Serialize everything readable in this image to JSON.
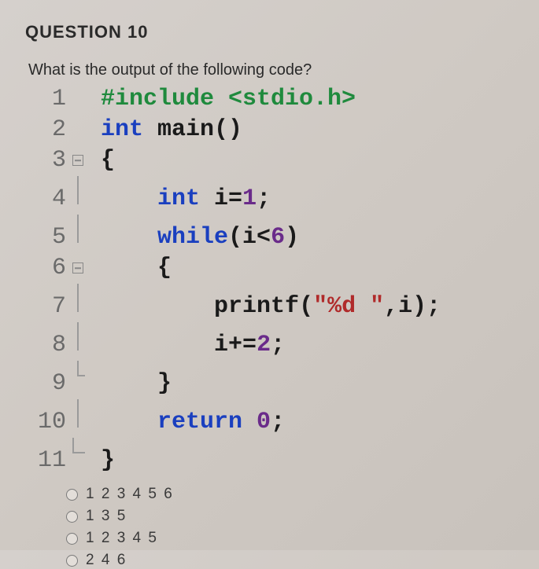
{
  "question_number": "QUESTION 10",
  "question_text": "What is the output of the following code?",
  "code": {
    "lines": [
      {
        "num": "1",
        "fold": "",
        "pre": "",
        "tokens": [
          {
            "t": "#include ",
            "cls": "c-preproc"
          },
          {
            "t": "<stdio.h>",
            "cls": "c-preproc"
          }
        ]
      },
      {
        "num": "2",
        "fold": "",
        "pre": "",
        "tokens": [
          {
            "t": "int ",
            "cls": "c-type"
          },
          {
            "t": "main",
            "cls": "c-black"
          },
          {
            "t": "()",
            "cls": "c-black"
          }
        ]
      },
      {
        "num": "3",
        "fold": "box",
        "pre": "",
        "tokens": [
          {
            "t": "{",
            "cls": "c-black"
          }
        ]
      },
      {
        "num": "4",
        "fold": "line",
        "pre": "    ",
        "tokens": [
          {
            "t": "int ",
            "cls": "c-type"
          },
          {
            "t": "i",
            "cls": "c-black"
          },
          {
            "t": "=",
            "cls": "c-black"
          },
          {
            "t": "1",
            "cls": "c-number"
          },
          {
            "t": ";",
            "cls": "c-black"
          }
        ]
      },
      {
        "num": "5",
        "fold": "line",
        "pre": "    ",
        "tokens": [
          {
            "t": "while",
            "cls": "c-keyword"
          },
          {
            "t": "(i",
            "cls": "c-black"
          },
          {
            "t": "<",
            "cls": "c-black"
          },
          {
            "t": "6",
            "cls": "c-number"
          },
          {
            "t": ")",
            "cls": "c-black"
          }
        ]
      },
      {
        "num": "6",
        "fold": "box",
        "pre": "    ",
        "tokens": [
          {
            "t": "{",
            "cls": "c-black"
          }
        ]
      },
      {
        "num": "7",
        "fold": "line",
        "pre": "        ",
        "tokens": [
          {
            "t": "printf",
            "cls": "c-black"
          },
          {
            "t": "(",
            "cls": "c-black"
          },
          {
            "t": "\"%d \"",
            "cls": "c-string"
          },
          {
            "t": ",i);",
            "cls": "c-black"
          }
        ]
      },
      {
        "num": "8",
        "fold": "line",
        "pre": "        ",
        "tokens": [
          {
            "t": "i",
            "cls": "c-black"
          },
          {
            "t": "+=",
            "cls": "c-black"
          },
          {
            "t": "2",
            "cls": "c-number"
          },
          {
            "t": ";",
            "cls": "c-black"
          }
        ]
      },
      {
        "num": "9",
        "fold": "tee",
        "pre": "    ",
        "tokens": [
          {
            "t": "}",
            "cls": "c-black"
          }
        ]
      },
      {
        "num": "10",
        "fold": "line",
        "pre": "    ",
        "tokens": [
          {
            "t": "return ",
            "cls": "c-keyword"
          },
          {
            "t": "0",
            "cls": "c-number"
          },
          {
            "t": ";",
            "cls": "c-black"
          }
        ]
      },
      {
        "num": "11",
        "fold": "end",
        "pre": "",
        "tokens": [
          {
            "t": "}",
            "cls": "c-black"
          }
        ]
      }
    ]
  },
  "answers": [
    {
      "label": "1 2 3 4 5 6"
    },
    {
      "label": "1 3 5"
    },
    {
      "label": "1 2 3 4 5"
    },
    {
      "label": "2 4 6"
    }
  ]
}
